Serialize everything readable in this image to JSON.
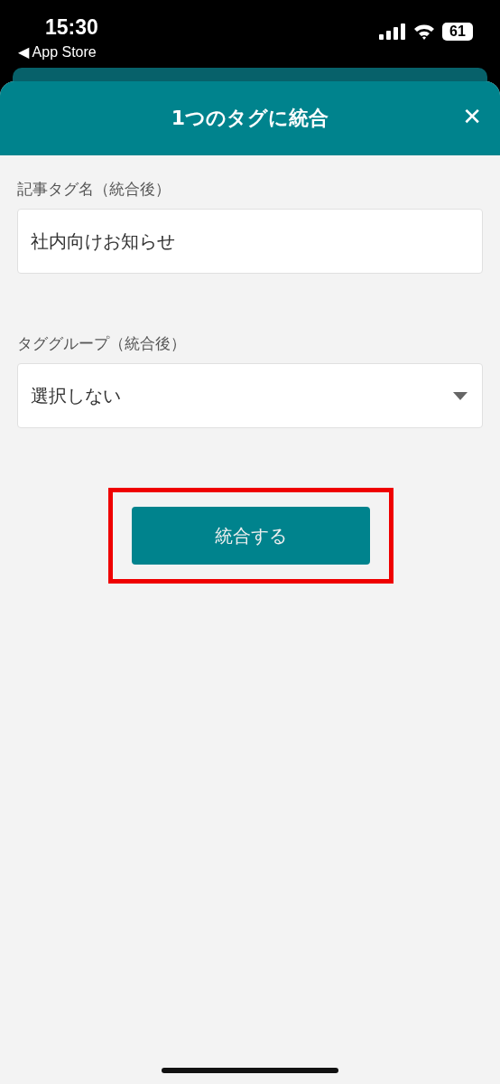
{
  "status_bar": {
    "time": "15:30",
    "back_link": "◀ App Store",
    "battery": "61"
  },
  "modal": {
    "title": "1つのタグに統合",
    "close": "✕"
  },
  "fields": [
    {
      "kind": "text",
      "label": "記事タグ名（統合後）",
      "value": "社内向けお知らせ"
    },
    {
      "kind": "select",
      "label": "タググループ（統合後）",
      "value": "選択しない"
    }
  ],
  "submit_button": {
    "label": "統合する",
    "highlighted": true
  }
}
